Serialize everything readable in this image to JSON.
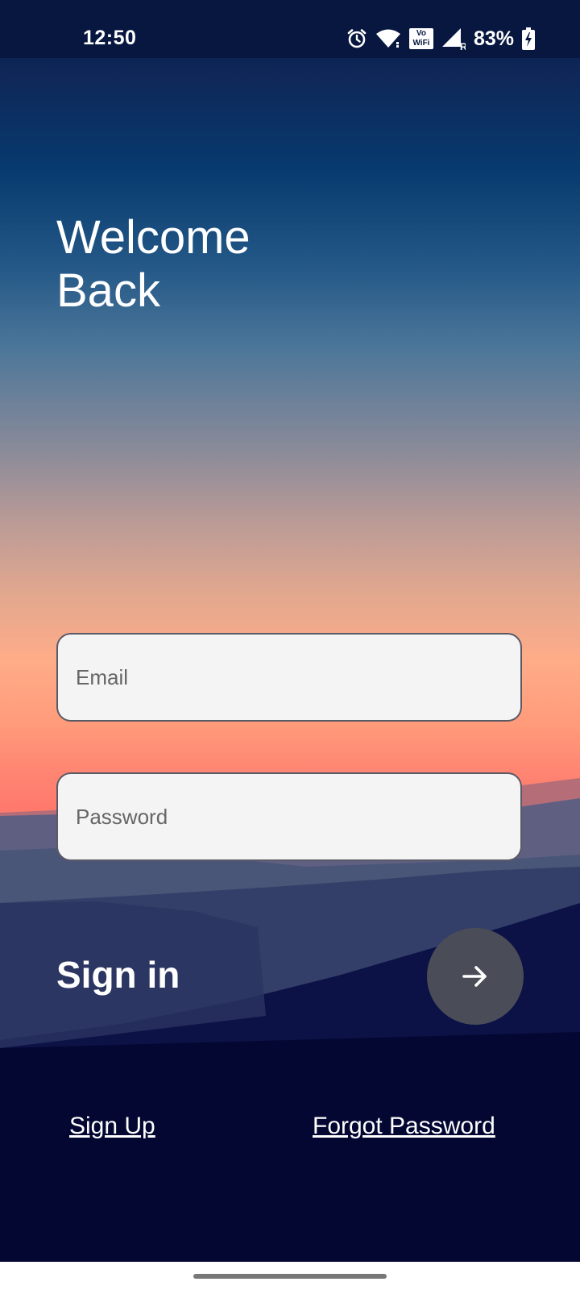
{
  "status_bar": {
    "time": "12:50",
    "icons": [
      "alarm-icon",
      "wifi-icon",
      "volte-wifi-icon",
      "signal-icon",
      "battery-charging-icon"
    ],
    "volte_label_top": "Vo",
    "volte_label_bottom": "WiFi",
    "roaming_label": "R",
    "battery_percent": "83%"
  },
  "header": {
    "welcome_line1": "Welcome",
    "welcome_line2": "Back"
  },
  "form": {
    "email": {
      "placeholder": "Email",
      "value": ""
    },
    "password": {
      "placeholder": "Password",
      "value": ""
    },
    "signin_label": "Sign in",
    "submit_icon": "arrow-right-icon"
  },
  "links": {
    "signup": "Sign Up",
    "forgot_password": "Forgot Password"
  },
  "colors": {
    "status_bar_bg": "#07173f",
    "field_bg": "#f4f4f4",
    "submit_button_bg": "#4a4d57",
    "bottom_bg": "#030732",
    "text": "#ffffff"
  }
}
